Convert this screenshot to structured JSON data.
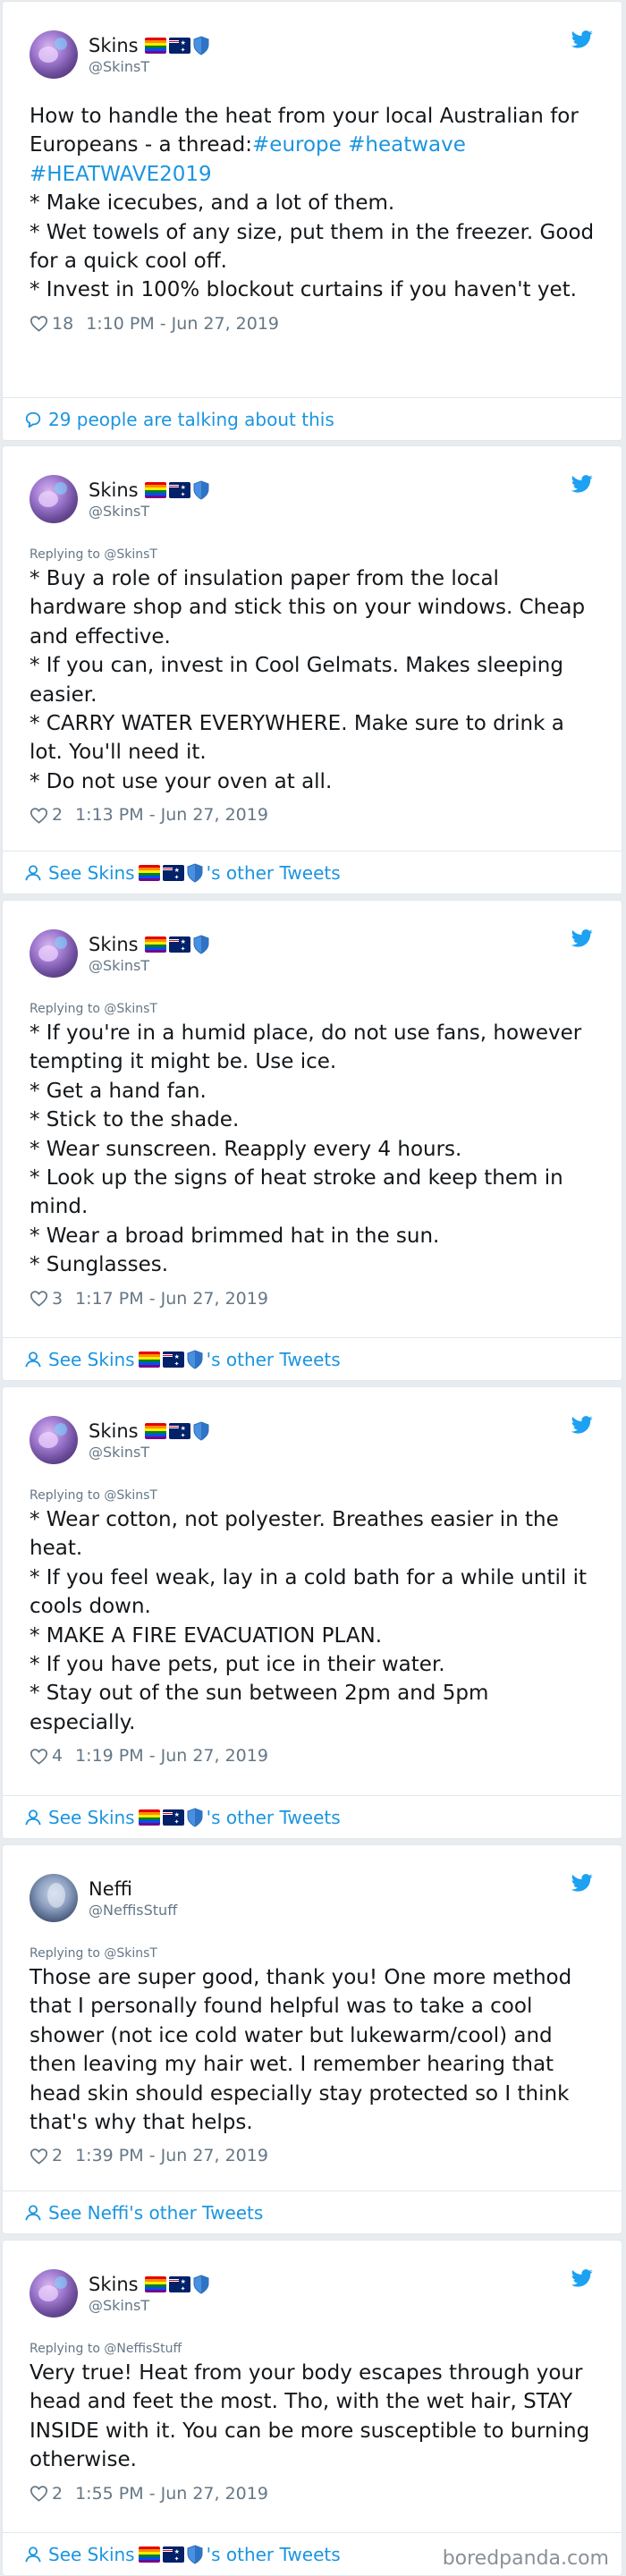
{
  "tweets": [
    {
      "name": "Skins",
      "handle": "@SkinsT",
      "reply_to": "",
      "text_parts": [
        "How to handle the heat from your local Australian for Europeans - a thread:",
        "#europe #heatwave #HEATWAVE2019",
        "\n* Make icecubes, and a lot of them.\n* Wet towels of any size, put them in the freezer. Good for a quick cool off.\n* Invest in 100% blockout curtains if you haven't yet."
      ],
      "likes": "18",
      "timestamp": "1:10 PM - Jun 27, 2019",
      "footer": "29 people are talking about this"
    },
    {
      "name": "Skins",
      "handle": "@SkinsT",
      "reply_to": "Replying to @SkinsT",
      "text": "* Buy a role of insulation paper from the local hardware shop and stick this on your windows. Cheap and effective.\n* If you can, invest in Cool Gelmats. Makes sleeping easier.\n* CARRY WATER EVERYWHERE. Make sure to drink a lot. You'll need it.\n* Do not use your oven at all.",
      "likes": "2",
      "timestamp": "1:13 PM - Jun 27, 2019",
      "footer_pre": "See Skins",
      "footer_post": "'s other Tweets"
    },
    {
      "name": "Skins",
      "handle": "@SkinsT",
      "reply_to": "Replying to @SkinsT",
      "text": "* If you're in a humid place, do not use fans, however tempting it might be. Use ice.\n* Get a hand fan.\n* Stick to the shade.\n* Wear sunscreen. Reapply every 4 hours.\n* Look up the signs of heat stroke and keep them in mind.\n* Wear a broad brimmed hat in the sun.\n* Sunglasses.",
      "likes": "3",
      "timestamp": "1:17 PM - Jun 27, 2019",
      "footer_pre": "See Skins",
      "footer_post": "'s other Tweets"
    },
    {
      "name": "Skins",
      "handle": "@SkinsT",
      "reply_to": "Replying to @SkinsT",
      "text": "* Wear cotton, not polyester. Breathes easier in the heat.\n* If you feel weak, lay in a cold bath for a while until it cools down.\n* MAKE A FIRE EVACUATION PLAN.\n* If you have pets, put ice in their water.\n* Stay out of the sun between 2pm and 5pm especially.",
      "likes": "4",
      "timestamp": "1:19 PM - Jun 27, 2019",
      "footer_pre": "See Skins",
      "footer_post": "'s other Tweets"
    },
    {
      "name": "Neffi",
      "handle": "@NeffisStuff",
      "reply_to": "Replying to @SkinsT",
      "text": "Those are super good, thank you! One more method that I personally found helpful was to take a cool shower (not ice cold water but lukewarm/cool) and then leaving my hair wet. I remember hearing that head skin should especially stay protected so I think that's why that helps.",
      "likes": "2",
      "timestamp": "1:39 PM - Jun 27, 2019",
      "footer": "See Neffi's other Tweets"
    },
    {
      "name": "Skins",
      "handle": "@SkinsT",
      "reply_to": "Replying to @NeffisStuff",
      "text": "Very true! Heat from your body escapes through your head and feet the most. Tho, with the wet hair, STAY INSIDE with it. You can be more susceptible to burning otherwise.",
      "likes": "2",
      "timestamp": "1:55 PM - Jun 27, 2019",
      "footer_pre": "See Skins",
      "footer_post": "'s other Tweets"
    }
  ],
  "icons": {
    "bird": "twitter-bird-icon",
    "heart": "heart-icon",
    "comment": "comment-icon",
    "profile": "profile-icon"
  },
  "colors": {
    "accent": "#1b95e0",
    "muted": "#657786",
    "text": "#14171a"
  },
  "watermark": "boredpanda.com"
}
